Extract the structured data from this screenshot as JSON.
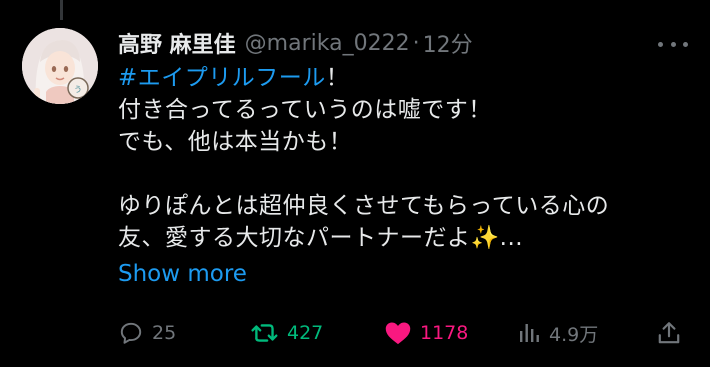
{
  "tweet": {
    "display_name": "高野 麻里佳",
    "handle": "@marika_0222",
    "separator": "·",
    "time": "12分",
    "text": {
      "hashtag": "#エイプリルフール",
      "line1_rest": "！",
      "line2": "付き合ってるっていうのは嘘です！",
      "line3": "でも、他は本当かも！",
      "line4": "ゆりぽんとは超仲良くさせてもらっている心の",
      "line5": "友、愛する大切なパートナーだよ✨..."
    },
    "show_more": "Show more"
  },
  "actions": {
    "replies": "25",
    "retweets": "427",
    "likes": "1178",
    "views": "4.9万"
  },
  "icons": {
    "more": "more-horizontal-icon",
    "reply": "reply-bubble-icon",
    "retweet": "retweet-icon",
    "like": "heart-icon",
    "views": "analytics-bars-icon",
    "share": "share-upload-icon"
  },
  "colors": {
    "background": "#000000",
    "text": "#e7e9ea",
    "muted": "#71767b",
    "link": "#1d9bf0",
    "retweet_active": "#00ba7c",
    "like_active": "#f91880"
  }
}
